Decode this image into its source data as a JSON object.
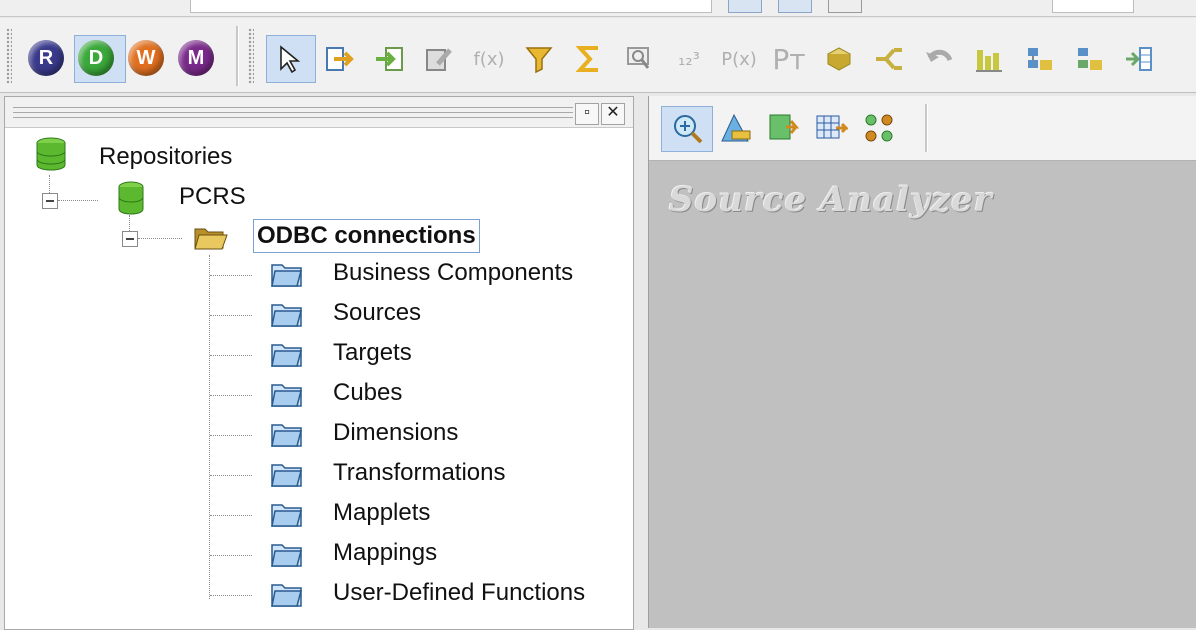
{
  "colors": {
    "r_button": "#3a3a8c",
    "d_button": "#3aa83a",
    "w_button": "#e07020",
    "m_button": "#7a2a8a",
    "workspace_bg": "#c0c0c0",
    "selection_border": "#7aa0d4"
  },
  "clients": [
    {
      "letter": "R",
      "name": "repository-manager-button",
      "color": "#3a3a8c"
    },
    {
      "letter": "D",
      "name": "designer-button",
      "color": "#3aa83a",
      "selected": true
    },
    {
      "letter": "W",
      "name": "workflow-manager-button",
      "color": "#e07020"
    },
    {
      "letter": "M",
      "name": "monitor-button",
      "color": "#7a2a8a"
    }
  ],
  "toolbar_tools": [
    {
      "name": "pointer-tool",
      "icon": "arrow-pointer-icon",
      "glyph": ""
    },
    {
      "name": "export-tool",
      "icon": "export-icon",
      "glyph": ""
    },
    {
      "name": "import-tool",
      "icon": "import-icon",
      "glyph": ""
    },
    {
      "name": "edit-tool",
      "icon": "edit-icon",
      "glyph": ""
    },
    {
      "name": "function-tool",
      "icon": "function-icon",
      "glyph": "f(x)"
    },
    {
      "name": "filter-tool",
      "icon": "filter-icon",
      "glyph": ""
    },
    {
      "name": "sum-tool",
      "icon": "sigma-icon",
      "glyph": "Σ"
    },
    {
      "name": "lookup-tool",
      "icon": "lookup-icon",
      "glyph": ""
    },
    {
      "name": "sequence-tool",
      "icon": "sequence-icon",
      "glyph": "₁₂³"
    },
    {
      "name": "parameter-tool",
      "icon": "parameter-icon",
      "glyph": "P(x)"
    },
    {
      "name": "parameter-transform-tool",
      "icon": "transform-icon",
      "glyph": "Pᴛ"
    },
    {
      "name": "joiner-tool",
      "icon": "joiner-icon",
      "glyph": ""
    },
    {
      "name": "router-tool",
      "icon": "router-icon",
      "glyph": ""
    },
    {
      "name": "undo-tool",
      "icon": "undo-icon",
      "glyph": ""
    },
    {
      "name": "aggregator-tool",
      "icon": "bar-chart-icon",
      "glyph": ""
    },
    {
      "name": "rank-tool",
      "icon": "rank-icon",
      "glyph": ""
    },
    {
      "name": "sorter-tool",
      "icon": "sorter-icon",
      "glyph": ""
    },
    {
      "name": "union-tool",
      "icon": "union-icon",
      "glyph": ""
    }
  ],
  "navigator": {
    "root": "Repositories",
    "repository": "PCRS",
    "folder": "ODBC connections",
    "nodes": [
      "Business Components",
      "Sources",
      "Targets",
      "Cubes",
      "Dimensions",
      "Transformations",
      "Mapplets",
      "Mappings",
      "User-Defined Functions"
    ]
  },
  "pane_controls": {
    "restore": "▫",
    "close": "✕"
  },
  "workspace": {
    "title": "Source Analyzer",
    "tools": [
      "source-analyzer-icon",
      "target-designer-icon",
      "transformation-developer-icon",
      "mapplet-designer-icon",
      "mapping-designer-icon"
    ]
  }
}
